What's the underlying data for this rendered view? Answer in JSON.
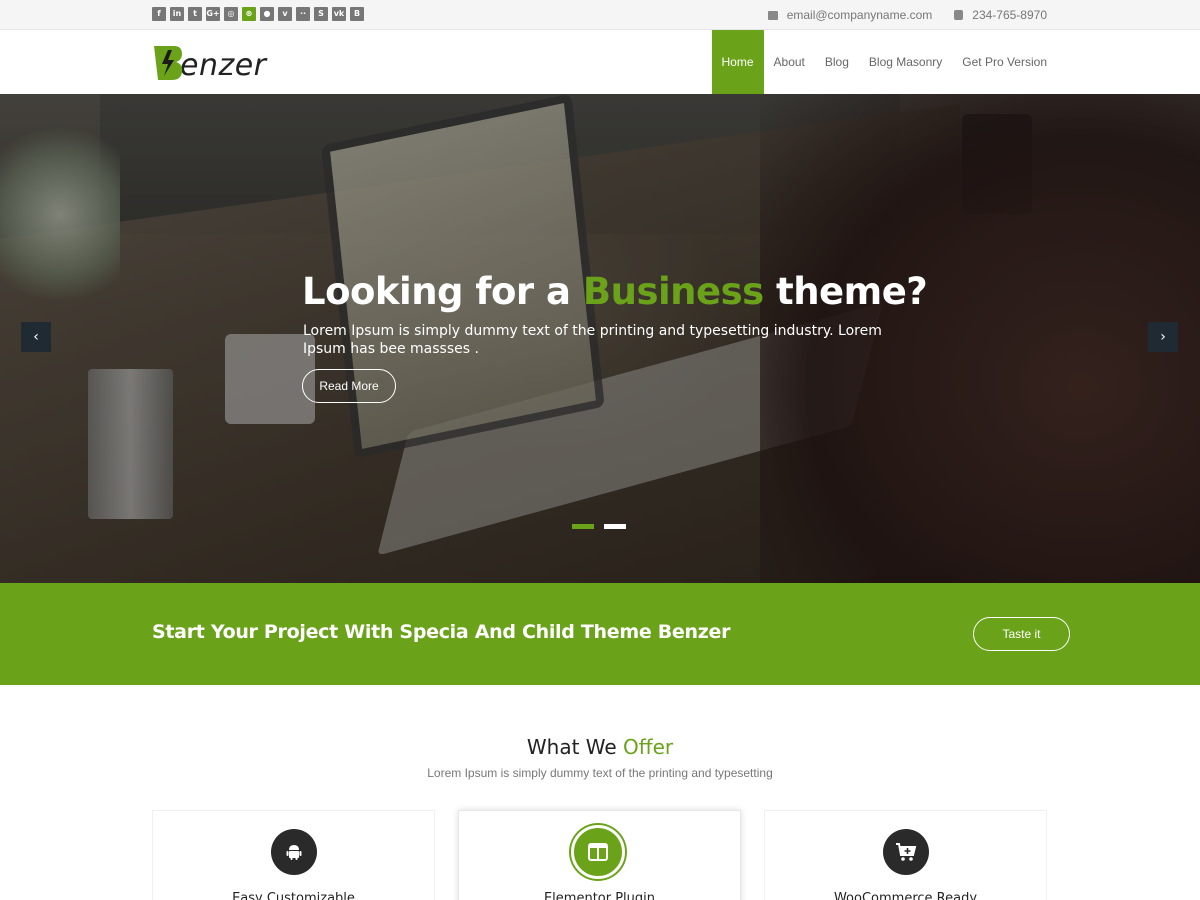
{
  "topbar": {
    "socials": [
      {
        "icon": "facebook-icon",
        "glyph": "f"
      },
      {
        "icon": "linkedin-icon",
        "glyph": "in"
      },
      {
        "icon": "twitter-icon",
        "glyph": "t"
      },
      {
        "icon": "google-plus-icon",
        "glyph": "G+"
      },
      {
        "icon": "instagram-icon",
        "glyph": "◎"
      },
      {
        "icon": "dribbble-icon",
        "glyph": "⊛"
      },
      {
        "icon": "github-icon",
        "glyph": "●"
      },
      {
        "icon": "vimeo-icon",
        "glyph": "v"
      },
      {
        "icon": "flickr-icon",
        "glyph": "··"
      },
      {
        "icon": "skype-icon",
        "glyph": "S"
      },
      {
        "icon": "vk-icon",
        "glyph": "vk"
      },
      {
        "icon": "behance-icon",
        "glyph": "B"
      }
    ],
    "email": "email@companyname.com",
    "phone": "234-765-8970"
  },
  "header": {
    "logo_text": "enzer",
    "nav": [
      "Home",
      "About",
      "Blog",
      "Blog Masonry",
      "Get Pro Version"
    ]
  },
  "hero": {
    "title_before": "Looking for a ",
    "title_highlight": "Business",
    "title_after": " theme?",
    "text": "Lorem Ipsum is simply dummy text of the printing and typesetting industry. Lorem Ipsum has bee massses .",
    "button": "Read More",
    "prev": "‹",
    "next": "›"
  },
  "cta": {
    "text": "Start Your Project With Specia And Child Theme Benzer",
    "button": "Taste it"
  },
  "offer": {
    "title_before": "What We ",
    "title_highlight": "Offer",
    "subtitle": "Lorem Ipsum is simply dummy text of the printing and typesetting",
    "cards": [
      {
        "label": "Easy Customizable",
        "icon": "android-icon"
      },
      {
        "label": "Elementor Plugin",
        "icon": "layout-icon"
      },
      {
        "label": "WooCommerce Ready",
        "icon": "cart-icon"
      }
    ]
  },
  "colors": {
    "accent": "#6aa319",
    "dark": "#2a2a2a"
  }
}
